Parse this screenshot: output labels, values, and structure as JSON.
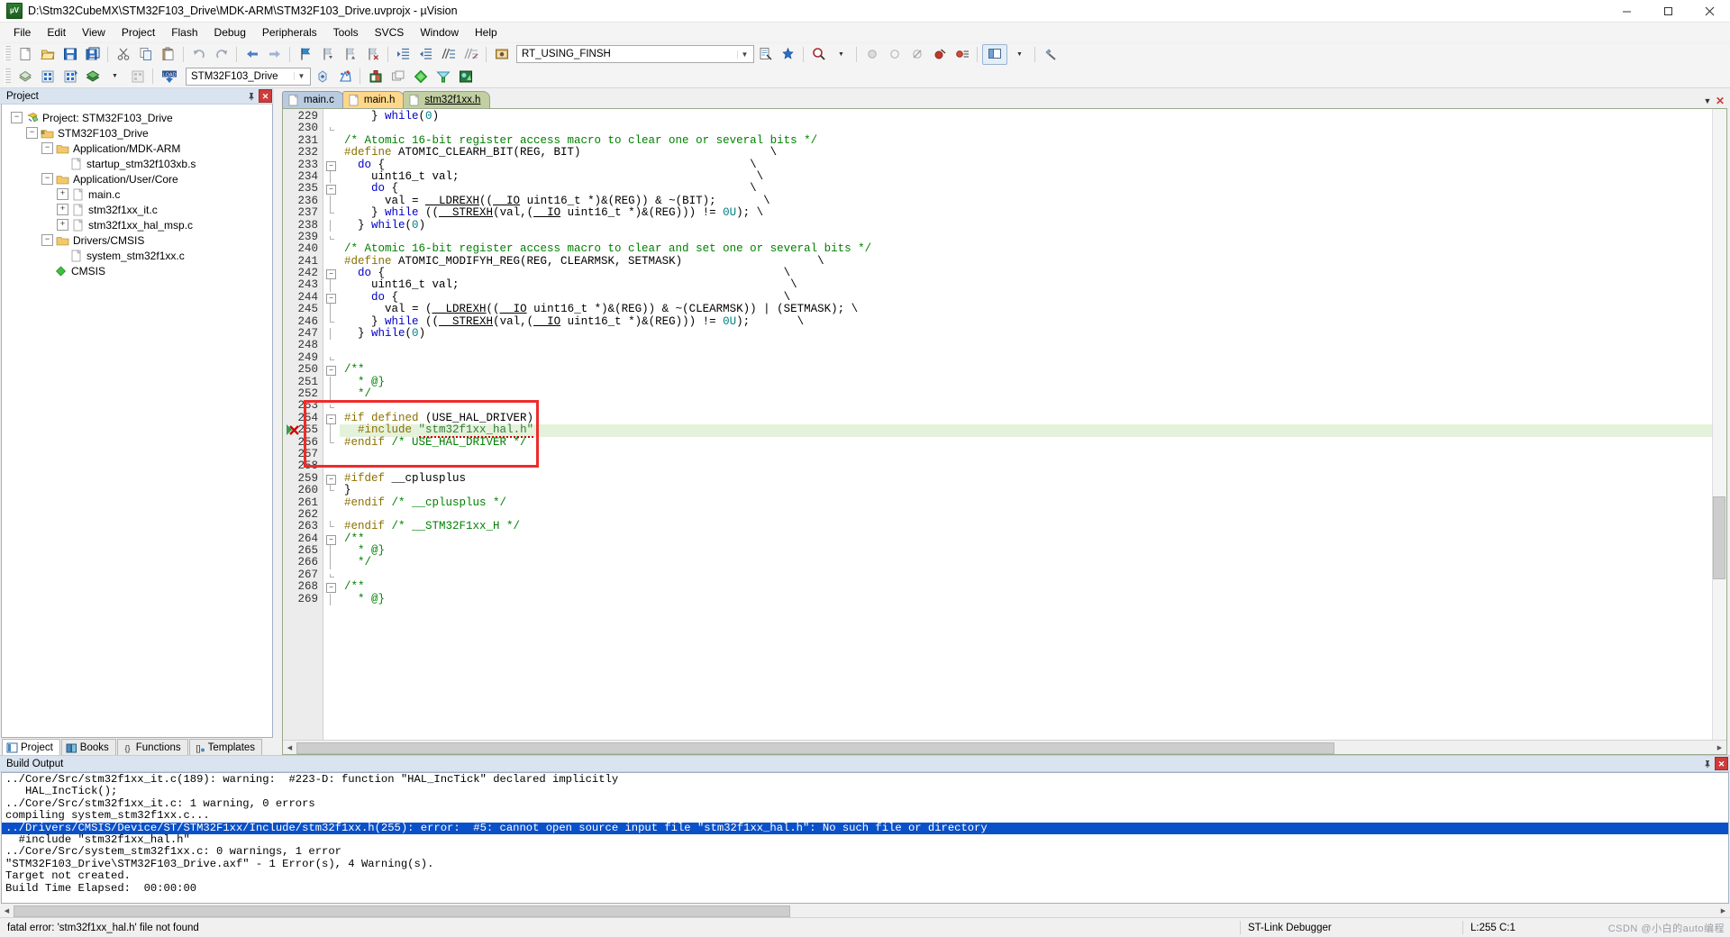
{
  "window": {
    "title": "D:\\Stm32CubeMX\\STM32F103_Drive\\MDK-ARM\\STM32F103_Drive.uvprojx - µVision",
    "app_icon": "uvision-icon",
    "minimize_label": "—",
    "maximize_label": "❐",
    "close_label": "✕"
  },
  "menu": [
    {
      "label": "File"
    },
    {
      "label": "Edit"
    },
    {
      "label": "View"
    },
    {
      "label": "Project"
    },
    {
      "label": "Flash"
    },
    {
      "label": "Debug"
    },
    {
      "label": "Peripherals"
    },
    {
      "label": "Tools"
    },
    {
      "label": "SVCS"
    },
    {
      "label": "Window"
    },
    {
      "label": "Help"
    }
  ],
  "toolbar": {
    "target_combo_value": "RT_USING_FINSH",
    "project_combo_value": "STM32F103_Drive",
    "dropdown_arrow": "▼",
    "items": [
      "new-file-icon",
      "open-file-icon",
      "save-icon",
      "save-all-icon",
      "cut-icon",
      "copy-icon",
      "paste-icon",
      "undo-icon",
      "redo-icon",
      "navigate-back-icon",
      "navigate-forward-icon",
      "bookmark-toggle-icon",
      "bookmark-prev-icon",
      "bookmark-next-icon",
      "bookmark-clear-icon",
      "indent-icon",
      "outdent-icon",
      "comment-icon",
      "uncomment-icon",
      "target-options-icon",
      "find-in-files-icon",
      "insert-bookmark-icon",
      "magnifier-icon"
    ],
    "items2": [
      "translate-icon",
      "build-icon",
      "rebuild-icon",
      "batch-build-icon",
      "stop-build-icon",
      "download-icon",
      "target-options-icon",
      "debug-session-icon",
      "register-window-icon",
      "component-manager-icon",
      "pack-installer-icon",
      "configuration-wizard-icon"
    ]
  },
  "project_panel": {
    "title": "Project",
    "pin_icon": "pin-icon",
    "close_icon": "close-icon",
    "tree": [
      {
        "depth": 0,
        "label": "Project: STM32F103_Drive",
        "expander": "-",
        "icon": "project-icon"
      },
      {
        "depth": 1,
        "label": "STM32F103_Drive",
        "expander": "-",
        "icon": "target-folder-icon"
      },
      {
        "depth": 2,
        "label": "Application/MDK-ARM",
        "expander": "-",
        "icon": "group-folder-icon"
      },
      {
        "depth": 3,
        "label": "startup_stm32f103xb.s",
        "expander": "",
        "icon": "file-icon"
      },
      {
        "depth": 2,
        "label": "Application/User/Core",
        "expander": "-",
        "icon": "group-folder-icon"
      },
      {
        "depth": 3,
        "label": "main.c",
        "expander": "+",
        "icon": "file-icon"
      },
      {
        "depth": 3,
        "label": "stm32f1xx_it.c",
        "expander": "+",
        "icon": "file-icon"
      },
      {
        "depth": 3,
        "label": "stm32f1xx_hal_msp.c",
        "expander": "+",
        "icon": "file-icon"
      },
      {
        "depth": 2,
        "label": "Drivers/CMSIS",
        "expander": "-",
        "icon": "group-folder-icon"
      },
      {
        "depth": 3,
        "label": "system_stm32f1xx.c",
        "expander": "",
        "icon": "file-icon"
      },
      {
        "depth": 2,
        "label": "CMSIS",
        "expander": "",
        "icon": "cmsis-icon"
      }
    ],
    "tabs": [
      {
        "label": "Project",
        "icon": "project-tab-icon",
        "active": true
      },
      {
        "label": "Books",
        "icon": "books-tab-icon",
        "active": false
      },
      {
        "label": "Functions",
        "icon": "functions-tab-icon",
        "active": false
      },
      {
        "label": "Templates",
        "icon": "templates-tab-icon",
        "active": false
      }
    ]
  },
  "editor": {
    "tabs": [
      {
        "label": "main.c",
        "active": false
      },
      {
        "label": "main.h",
        "active": false
      },
      {
        "label": "stm32f1xx.h",
        "active": true
      }
    ],
    "tab_nav_down": "▼",
    "tab_close": "✕",
    "first_line": 229,
    "lines": [
      {
        "n": 229,
        "fold": "",
        "html": "    } <span class='k'>while</span>(<span class='num'>0</span>)"
      },
      {
        "n": 230,
        "fold": "end",
        "html": ""
      },
      {
        "n": 231,
        "fold": "",
        "html": "<span class='c'>/* Atomic 16-bit register access macro to clear one or several bits */</span>"
      },
      {
        "n": 232,
        "fold": "",
        "html": "<span class='pp'>#define</span> ATOMIC_CLEARH_BIT(REG, BIT)                            \\"
      },
      {
        "n": 233,
        "fold": "box",
        "html": "  <span class='k'>do</span> {                                                      \\"
      },
      {
        "n": 234,
        "fold": "line",
        "html": "    uint16_t val;                                            \\"
      },
      {
        "n": 235,
        "fold": "box",
        "html": "    <span class='k'>do</span> {                                                    \\"
      },
      {
        "n": 236,
        "fold": "line",
        "html": "      val = <span class='u'>__LDREXH</span>((<span class='u'>__IO</span> uint16_t *)&amp;(REG)) &amp; ~(BIT);       \\"
      },
      {
        "n": 237,
        "fold": "endline",
        "html": "    } <span class='k'>while</span> ((<span class='u'>__STREXH</span>(val,(<span class='u'>__IO</span> uint16_t *)&amp;(REG))) != <span class='num'>0U</span>); \\"
      },
      {
        "n": 238,
        "fold": "line",
        "html": "  } <span class='k'>while</span>(<span class='num'>0</span>)"
      },
      {
        "n": 239,
        "fold": "end",
        "html": ""
      },
      {
        "n": 240,
        "fold": "",
        "html": "<span class='c'>/* Atomic 16-bit register access macro to clear and set one or several bits */</span>"
      },
      {
        "n": 241,
        "fold": "",
        "html": "<span class='pp'>#define</span> ATOMIC_MODIFYH_REG(REG, CLEARMSK, SETMASK)                    \\"
      },
      {
        "n": 242,
        "fold": "box",
        "html": "  <span class='k'>do</span> {                                                           \\"
      },
      {
        "n": 243,
        "fold": "line",
        "html": "    uint16_t val;                                                 \\"
      },
      {
        "n": 244,
        "fold": "box",
        "html": "    <span class='k'>do</span> {                                                         \\"
      },
      {
        "n": 245,
        "fold": "line",
        "html": "      val = (<span class='u'>__LDREXH</span>((<span class='u'>__IO</span> uint16_t *)&amp;(REG)) &amp; ~(CLEARMSK)) | (SETMASK); \\"
      },
      {
        "n": 246,
        "fold": "endline",
        "html": "    } <span class='k'>while</span> ((<span class='u'>__STREXH</span>(val,(<span class='u'>__IO</span> uint16_t *)&amp;(REG))) != <span class='num'>0U</span>);       \\"
      },
      {
        "n": 247,
        "fold": "line",
        "html": "  } <span class='k'>while</span>(<span class='num'>0</span>)"
      },
      {
        "n": 248,
        "fold": "",
        "html": ""
      },
      {
        "n": 249,
        "fold": "end",
        "html": ""
      },
      {
        "n": 250,
        "fold": "box",
        "html": "<span class='c'>/**</span>"
      },
      {
        "n": 251,
        "fold": "line",
        "html": "  <span class='c'>* @}</span>"
      },
      {
        "n": 252,
        "fold": "line",
        "html": "  <span class='c'>*/</span>"
      },
      {
        "n": 253,
        "fold": "end",
        "html": ""
      },
      {
        "n": 254,
        "fold": "box",
        "html": "<span class='pp'>#if defined</span> (USE_HAL_DRIVER)"
      },
      {
        "n": 255,
        "fold": "line",
        "html": "  <span class='pp'>#include</span> <span class='str wavy'>\"stm32f1xx_hal.h\"</span>",
        "highlight": true,
        "error_marker": true
      },
      {
        "n": 256,
        "fold": "endline",
        "html": "<span class='pp'>#endif</span> <span class='c'>/* USE_HAL_DRIVER */</span>"
      },
      {
        "n": 257,
        "fold": "",
        "html": ""
      },
      {
        "n": 258,
        "fold": "",
        "html": ""
      },
      {
        "n": 259,
        "fold": "box",
        "html": "<span class='pp'>#ifdef</span> __cplusplus"
      },
      {
        "n": 260,
        "fold": "endline",
        "html": "}"
      },
      {
        "n": 261,
        "fold": "",
        "html": "<span class='pp'>#endif</span> <span class='c'>/* __cplusplus */</span>"
      },
      {
        "n": 262,
        "fold": "",
        "html": ""
      },
      {
        "n": 263,
        "fold": "endline",
        "html": "<span class='pp'>#endif</span> <span class='c'>/* __STM32F1xx_H */</span>"
      },
      {
        "n": 264,
        "fold": "box",
        "html": "<span class='c'>/**</span>"
      },
      {
        "n": 265,
        "fold": "line",
        "html": "  <span class='c'>* @}</span>"
      },
      {
        "n": 266,
        "fold": "line",
        "html": "  <span class='c'>*/</span>"
      },
      {
        "n": 267,
        "fold": "end",
        "html": ""
      },
      {
        "n": 268,
        "fold": "box",
        "html": "<span class='c'>/**</span>"
      },
      {
        "n": 269,
        "fold": "line",
        "html": "  <span class='c'>* @}</span>"
      }
    ]
  },
  "build_output": {
    "title": "Build Output",
    "pin_icon": "pin-icon",
    "close_icon": "close-icon",
    "lines": [
      {
        "text": "../Core/Src/stm32f1xx_it.c(189): warning:  #223-D: function \"HAL_IncTick\" declared implicitly",
        "selected": false
      },
      {
        "text": "   HAL_IncTick();",
        "selected": false
      },
      {
        "text": "../Core/Src/stm32f1xx_it.c: 1 warning, 0 errors",
        "selected": false
      },
      {
        "text": "compiling system_stm32f1xx.c...",
        "selected": false
      },
      {
        "text": "../Drivers/CMSIS/Device/ST/STM32F1xx/Include/stm32f1xx.h(255): error:  #5: cannot open source input file \"stm32f1xx_hal.h\": No such file or directory",
        "selected": true
      },
      {
        "text": "  #include \"stm32f1xx_hal.h\"",
        "selected": false
      },
      {
        "text": "../Core/Src/system_stm32f1xx.c: 0 warnings, 1 error",
        "selected": false
      },
      {
        "text": "\"STM32F103_Drive\\STM32F103_Drive.axf\" - 1 Error(s), 4 Warning(s).",
        "selected": false
      },
      {
        "text": "Target not created.",
        "selected": false
      },
      {
        "text": "Build Time Elapsed:  00:00:00",
        "selected": false
      }
    ]
  },
  "status_bar": {
    "message": "fatal error: 'stm32f1xx_hal.h' file not found",
    "debugger": "ST-Link Debugger",
    "cursor": "L:255 C:1",
    "watermark": "CSDN @小白的auto编程"
  },
  "colors": {
    "accent": "#0a50c8",
    "error_box": "#ee2b2b",
    "highlight_line": "#e4f2dc",
    "panel_header": "#d9e4f0"
  }
}
